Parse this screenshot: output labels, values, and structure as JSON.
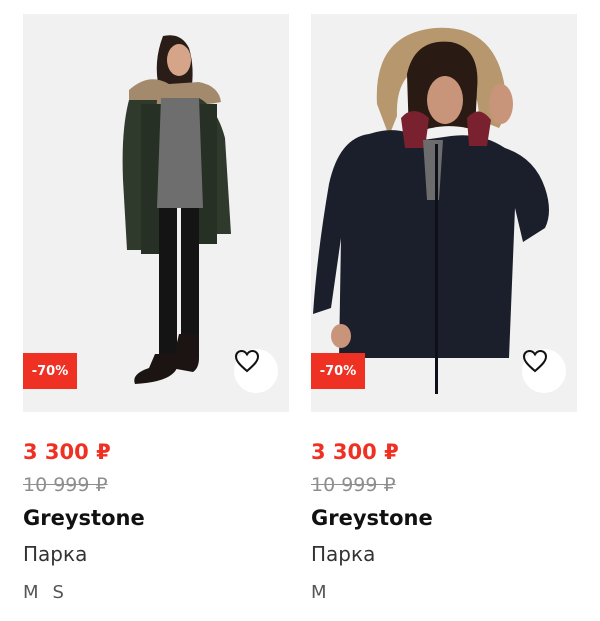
{
  "products": [
    {
      "discount_badge": "-70%",
      "price": "3 300 ₽",
      "old_price": "10 999 ₽",
      "brand": "Greystone",
      "type": "Парка",
      "sizes": [
        "M",
        "S"
      ]
    },
    {
      "discount_badge": "-70%",
      "price": "3 300 ₽",
      "old_price": "10 999 ₽",
      "brand": "Greystone",
      "type": "Парка",
      "sizes": [
        "M"
      ]
    }
  ],
  "colors": {
    "accent": "#ef3124",
    "old_price": "#8e8e8e",
    "photo_bg": "#f1f1f1"
  }
}
